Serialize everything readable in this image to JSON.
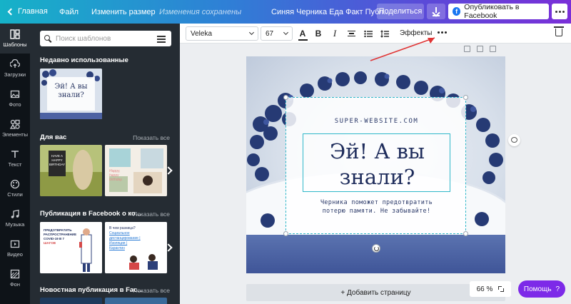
{
  "topbar": {
    "back_label": "Главная",
    "file_label": "Файл",
    "resize_label": "Изменить размер",
    "save_status": "Изменения сохранены",
    "doc_title": "Синяя Черника Еда Факт Публ...",
    "share_label": "Поделиться",
    "publish_label": "Опубликовать в Facebook",
    "facebook_letter": "f"
  },
  "rail": {
    "items": [
      {
        "label": "Шаблоны",
        "icon": "templates-icon"
      },
      {
        "label": "Загрузки",
        "icon": "upload-cloud-icon"
      },
      {
        "label": "Фото",
        "icon": "photo-icon"
      },
      {
        "label": "Элементы",
        "icon": "shapes-icon"
      },
      {
        "label": "Текст",
        "icon": "text-t-icon"
      },
      {
        "label": "Стили",
        "icon": "palette-icon"
      },
      {
        "label": "Музыка",
        "icon": "music-note-icon"
      },
      {
        "label": "Видео",
        "icon": "video-play-icon"
      },
      {
        "label": "Фон",
        "icon": "background-icon"
      }
    ]
  },
  "panel": {
    "search_placeholder": "Поиск шаблонов",
    "recent_title": "Недавно использованные",
    "recent_thumb": {
      "line1": "Эй! А вы",
      "line2": "знали?"
    },
    "foryou_title": "Для вас",
    "foryou_show_all": "Показать все",
    "foryou_thumb1": {
      "l1": "HAVE A",
      "l2": "HAPPY",
      "l3": "BIRTHDAY"
    },
    "foryou_thumb2": {
      "l1": "Happy,",
      "l2": "happy",
      "l3": "birthday."
    },
    "fb_posts_title": "Публикация в Facebook о ко...",
    "fb_posts_show_all": "Показать все",
    "covid_thumb": {
      "l1": "ПРЕДОТВРАТИТЬ",
      "l2": "РАСПРОСТРАНЕНИЕ",
      "l3": "COVID-19 В 7",
      "l4": "ШАГОВ"
    },
    "diff_thumb": {
      "q": "В чем разница?",
      "a1": "Социальное",
      "a2": "дистанцирование |",
      "a3": "Изоляция |",
      "a4": "Карантин"
    },
    "news_title": "Новостная публикация в Fac...",
    "news_show_all": "Показать все"
  },
  "toolbar": {
    "font_family": "Veleka",
    "font_size": "67",
    "text_color": "A",
    "bold": "B",
    "italic": "I",
    "effects_label": "Эффекты"
  },
  "design": {
    "site_url": "SUPER-WEBSITE.COM",
    "headline_line1": "Эй! А вы",
    "headline_line2": "знали?",
    "subtext_line1": "Черника поможет предотвратить",
    "subtext_line2": "потерю памяти. Не забывайте!",
    "accent_color": "#2fb7c9",
    "headline_color": "#1f2d5c"
  },
  "footer": {
    "add_page_label": "+ Добавить страницу",
    "zoom_level": "66 %",
    "help_label": "Помощь",
    "help_mark": "?"
  },
  "colors": {
    "brand_purple": "#7d2ae8",
    "panel_dark": "#252c33",
    "rail_dark": "#0e1318"
  }
}
